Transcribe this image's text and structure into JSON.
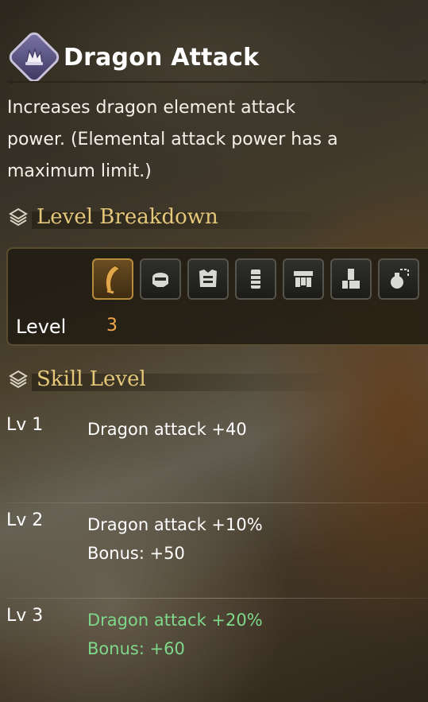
{
  "skill": {
    "name": "Dragon Attack",
    "icon": "dragon-attack-skill-icon",
    "description": "Increases dragon element attack power. (Elemental attack power has a maximum limit.)"
  },
  "level_breakdown": {
    "heading": "Level Breakdown",
    "equipment_slots": [
      {
        "icon": "weapon-icon",
        "active": true
      },
      {
        "icon": "helmet-icon",
        "active": false
      },
      {
        "icon": "chest-armor-icon",
        "active": false
      },
      {
        "icon": "arm-armor-icon",
        "active": false
      },
      {
        "icon": "waist-armor-icon",
        "active": false
      },
      {
        "icon": "leg-armor-icon",
        "active": false
      },
      {
        "icon": "talisman-icon",
        "active": false
      }
    ],
    "level_label": "Level",
    "level_value": "3"
  },
  "skill_level": {
    "heading": "Skill Level",
    "levels": [
      {
        "name": "Lv 1",
        "effects": [
          "Dragon attack +40"
        ],
        "active": false
      },
      {
        "name": "Lv 2",
        "effects": [
          "Dragon attack +10%",
          "Bonus: +50"
        ],
        "active": false
      },
      {
        "name": "Lv 3",
        "effects": [
          "Dragon attack +20%",
          "Bonus: +60"
        ],
        "active": true
      }
    ]
  },
  "colors": {
    "heading_gold": "#e5c77a",
    "level_value_orange": "#f2a84a",
    "active_green": "#7fd88a"
  }
}
